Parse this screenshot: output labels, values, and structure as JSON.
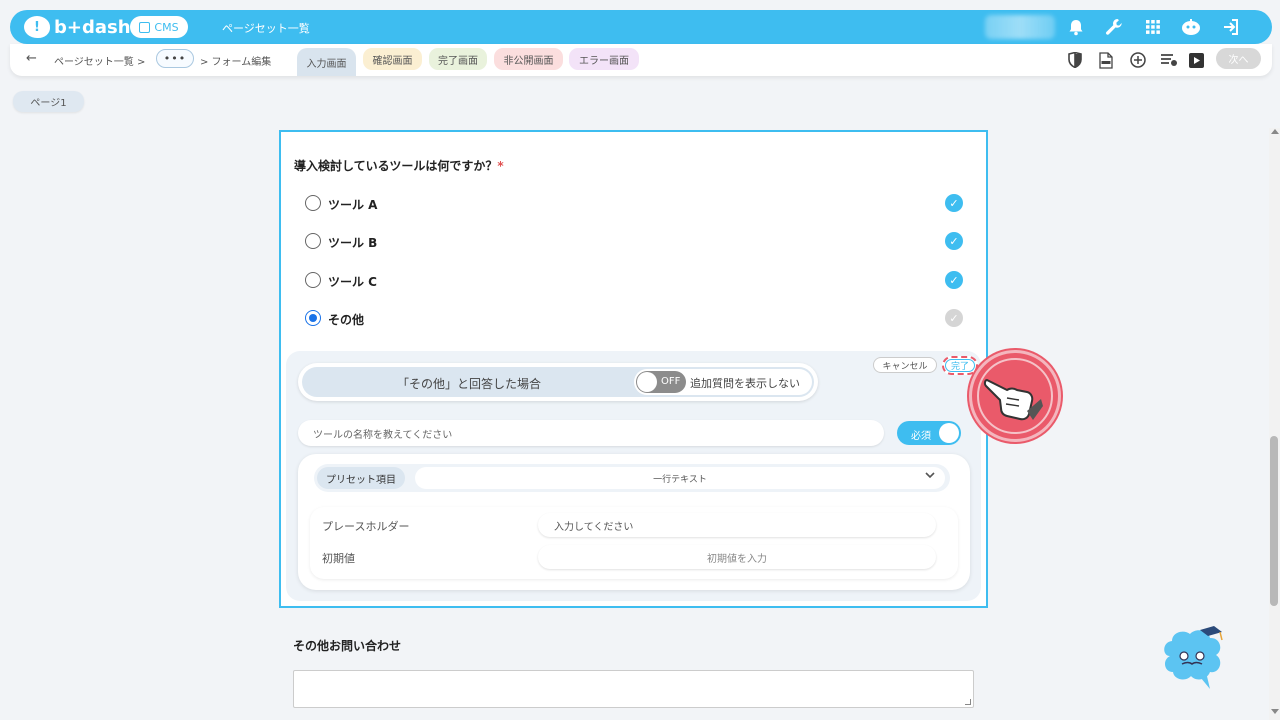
{
  "header": {
    "logo": "b+dash",
    "cms_label": "CMS",
    "title": "ページセット一覧",
    "icons": [
      "bell-icon",
      "wrench-icon",
      "grid-icon",
      "robot-icon",
      "logout-icon"
    ]
  },
  "subbar": {
    "crumb1": "ページセット一覧 >",
    "crumb_more": "•••",
    "crumb2": "> フォーム編集",
    "tabs": [
      "入力画面",
      "確認画面",
      "完了画面",
      "非公開画面",
      "エラー画面"
    ],
    "tools": [
      "shield-icon",
      "html-file-icon",
      "plus-circle-icon",
      "list-settings-icon",
      "play-icon"
    ],
    "next_label": "次へ"
  },
  "page_tab": "ページ1",
  "question": {
    "title": "導入検討しているツールは何ですか？",
    "required_mark": "*",
    "options": [
      {
        "label": "ツール A",
        "selected": false,
        "checked": true
      },
      {
        "label": "ツール B",
        "selected": false,
        "checked": true
      },
      {
        "label": "ツール C",
        "selected": false,
        "checked": true
      },
      {
        "label": "その他",
        "selected": true,
        "checked": false
      }
    ]
  },
  "condition": {
    "text": "「その他」と回答した場合",
    "toggle_state": "OFF",
    "toggle_desc": "追加質問を表示しない",
    "cancel_label": "キャンセル",
    "done_label": "完了"
  },
  "sub_question": {
    "placeholder": "ツールの名称を教えてください",
    "required_label": "必須",
    "preset_label": "プリセット項目",
    "preset_value": "一行テキスト",
    "placeholder_label": "プレースホルダー",
    "placeholder_value": "入力してください",
    "initial_label": "初期値",
    "initial_value": "初期値を入力"
  },
  "question2": {
    "title": "その他お問い合わせ"
  },
  "colors": {
    "brand": "#3ebdf0",
    "accent_red": "#ea5a6a",
    "radio_selected": "#1a73e8"
  }
}
